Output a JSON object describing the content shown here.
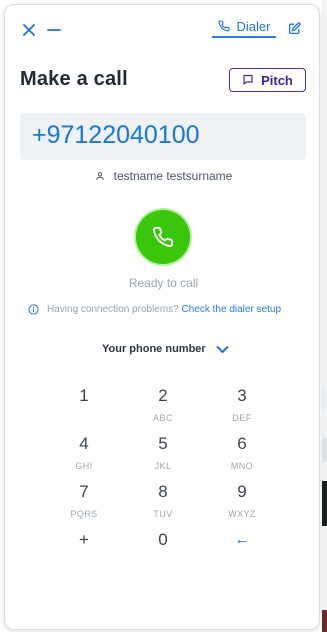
{
  "header": {
    "close_icon": "close-icon",
    "minimize_icon": "minimize-icon",
    "dialer_tab_label": "Dialer",
    "dialer_tab_icon": "phone-icon",
    "edit_icon": "edit-icon"
  },
  "main": {
    "title": "Make a call",
    "pitch_label": "Pitch",
    "phone_number": "+97122040100",
    "contact_name": "testname testsurname",
    "status": "Ready to call",
    "connection_prefix": "Having connection problems?",
    "connection_link": "Check the dialer setup",
    "your_phone_number_label": "Your phone number"
  },
  "keypad": [
    {
      "digit": "1",
      "letters": ""
    },
    {
      "digit": "2",
      "letters": "ABC"
    },
    {
      "digit": "3",
      "letters": "DEF"
    },
    {
      "digit": "4",
      "letters": "GHI"
    },
    {
      "digit": "5",
      "letters": "JKL"
    },
    {
      "digit": "6",
      "letters": "MNO"
    },
    {
      "digit": "7",
      "letters": "PQRS"
    },
    {
      "digit": "8",
      "letters": "TUV"
    },
    {
      "digit": "9",
      "letters": "WXYZ"
    },
    {
      "digit": "+",
      "letters": ""
    },
    {
      "digit": "0",
      "letters": ""
    },
    {
      "digit": "←",
      "letters": ""
    }
  ],
  "colors": {
    "accent": "#2173d8",
    "call_green": "#39c60b",
    "pitch_purple": "#4b2bb6"
  }
}
